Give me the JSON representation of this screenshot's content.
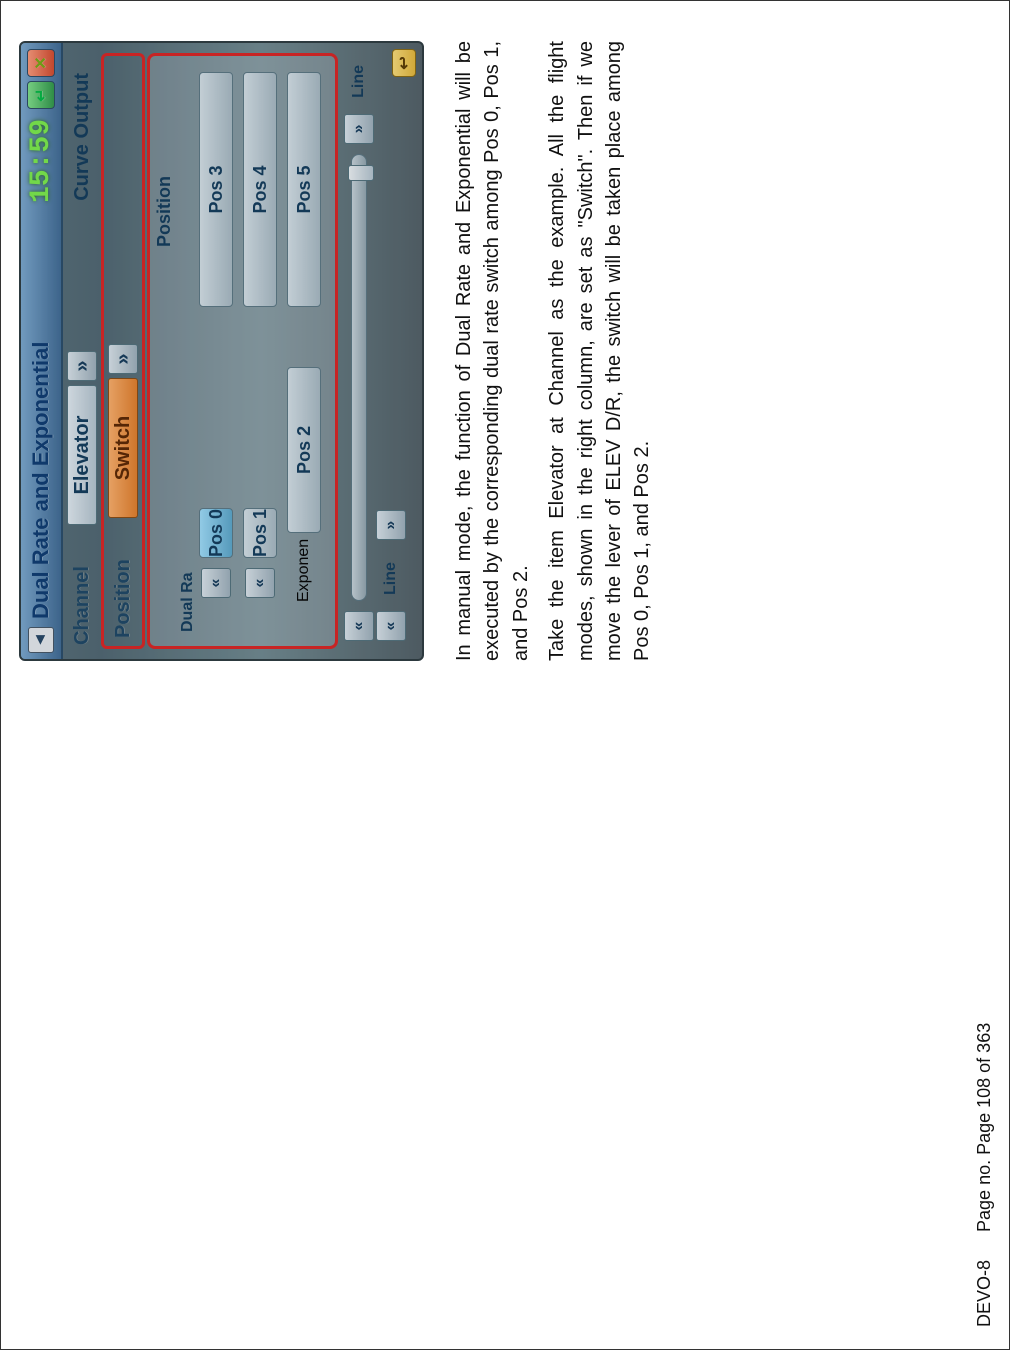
{
  "device": {
    "title": "Dual Rate and Exponential",
    "clock": "15:59",
    "channel_label": "Channel",
    "channel_value": "Elevator",
    "curve_output_label": "Curve Output",
    "position_label": "Position",
    "position_value": "Switch",
    "position_panel_title": "Position",
    "positions": [
      "Pos 0",
      "Pos 1",
      "Pos 2",
      "Pos 3",
      "Pos 4",
      "Pos 5"
    ],
    "dual_rate_label": "Dual Ra",
    "exponential_label": "Exponen",
    "line_label": "Line",
    "segment_label": "Line"
  },
  "caption": {
    "p1": "In manual mode, the function of Dual Rate and Exponential will be executed by the corresponding dual rate switch among Pos 0, Pos 1, and Pos 2.",
    "p2": "Take the item Elevator at Channel as the example. All the flight modes, shown in the right column, are set as \"Switch\". Then if we move the lever of ELEV D/R, the switch will be taken place among Pos 0, Pos 1, and Pos 2."
  },
  "footer": {
    "model": "DEVO-8",
    "page": "Page no. Page 108 of 363"
  }
}
